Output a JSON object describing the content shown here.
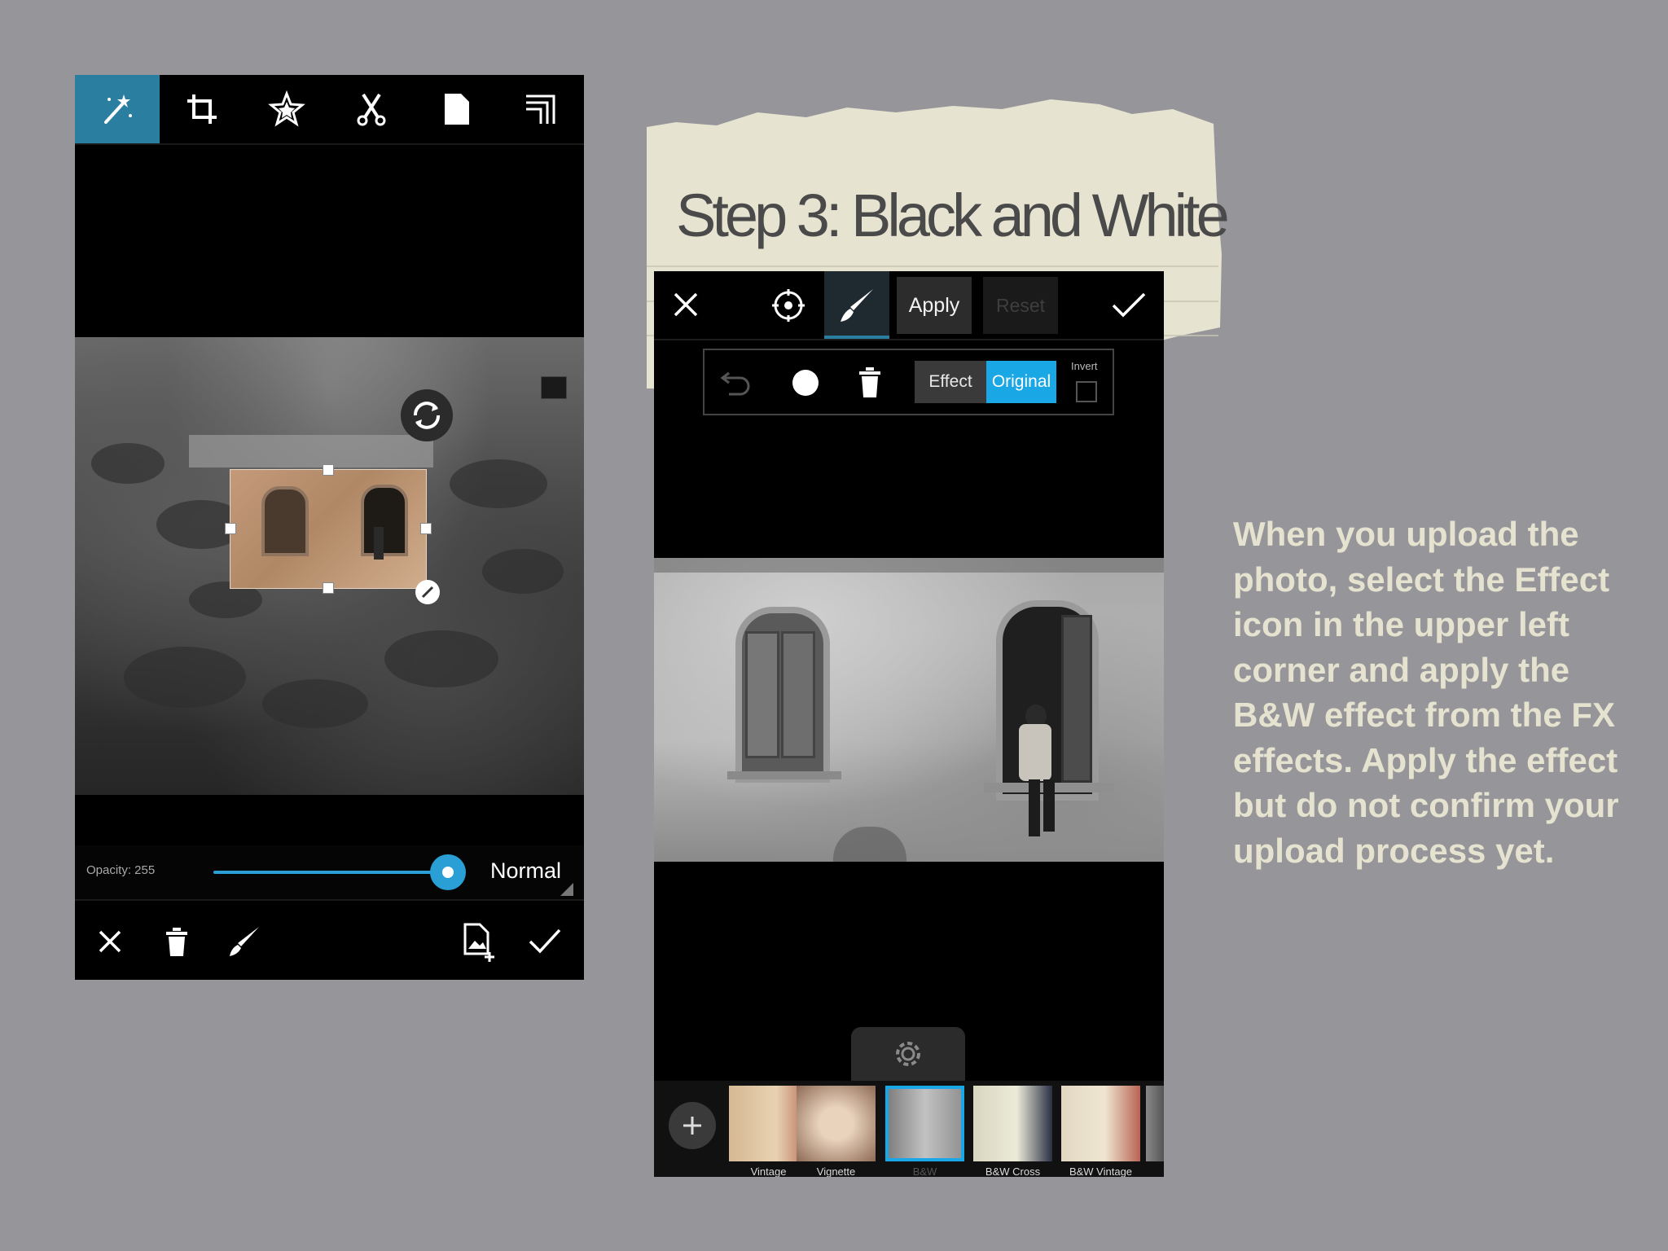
{
  "left_phone": {
    "toolbar": [
      "effects-wand-icon",
      "crop-icon",
      "sticker-star-icon",
      "cutout-scissors-icon",
      "page-icon",
      "frame-border-icon"
    ],
    "opacity_label": "Opacity: 255",
    "opacity_value": 255,
    "opacity_max": 255,
    "blend_mode": "Normal",
    "bottom": [
      "close-icon",
      "trash-icon",
      "brush-icon",
      "add-image-icon",
      "confirm-check-icon"
    ]
  },
  "title": "Step 3: Black and White",
  "right_phone": {
    "apply_label": "Apply",
    "reset_label": "Reset",
    "toggle": {
      "effect_label": "Effect",
      "original_label": "Original",
      "active": "Original"
    },
    "invert_label": "Invert",
    "filters": [
      {
        "label": "Vintage",
        "selected": false
      },
      {
        "label": "Vignette",
        "selected": false
      },
      {
        "label": "B&W",
        "selected": true
      },
      {
        "label": "B&W Cross",
        "selected": false
      },
      {
        "label": "B&W Vintage",
        "selected": false
      }
    ]
  },
  "description": "When you upload the photo, select the Effect icon in the upper left corner and apply the B&W effect from the FX effects. Apply the effect but do not confirm your upload process yet.",
  "colors": {
    "background": "#96969a",
    "accent": "#1aa7e6",
    "toolbar_active": "#2a7fa0",
    "description_text": "#e5e3cf"
  }
}
